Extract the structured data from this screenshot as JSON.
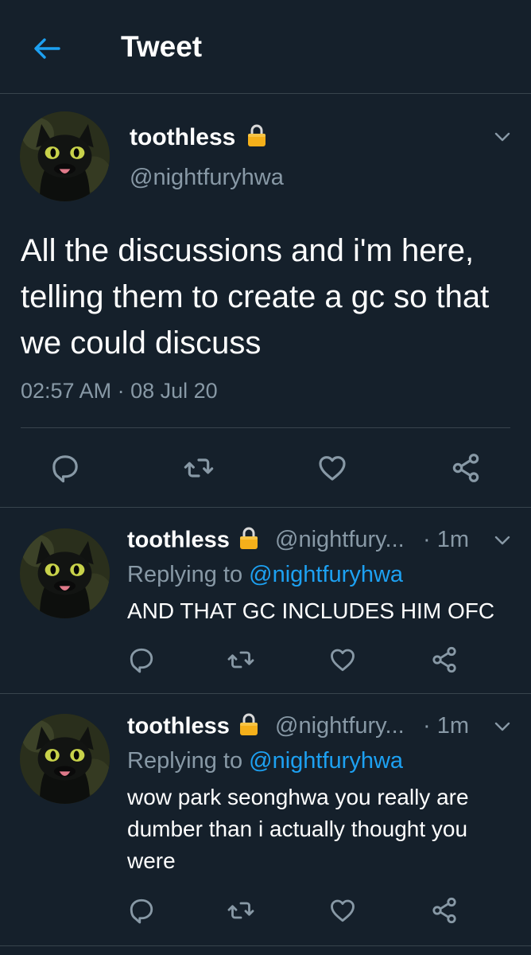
{
  "header": {
    "title": "Tweet"
  },
  "main_tweet": {
    "display_name": "toothless",
    "handle": "@nightfuryhwa",
    "text": "All the discussions and i'm here, telling them to create a gc so that we could discuss",
    "timestamp": "02:57 AM · 08 Jul 20"
  },
  "replies": [
    {
      "display_name": "toothless",
      "handle": "@nightfury...",
      "time": "· 1m",
      "replying_prefix": "Replying to ",
      "replying_handle": "@nightfuryhwa",
      "text": "AND THAT GC INCLUDES HIM OFC"
    },
    {
      "display_name": "toothless",
      "handle": "@nightfury...",
      "time": "· 1m",
      "replying_prefix": "Replying to ",
      "replying_handle": "@nightfuryhwa",
      "text": "wow park seonghwa you really are dumber than i actually thought you were"
    }
  ],
  "colors": {
    "background": "#15202b",
    "accent": "#1da1f2",
    "secondary_text": "#8899a6",
    "divider": "#38444d",
    "lock": "#f5b01a"
  }
}
